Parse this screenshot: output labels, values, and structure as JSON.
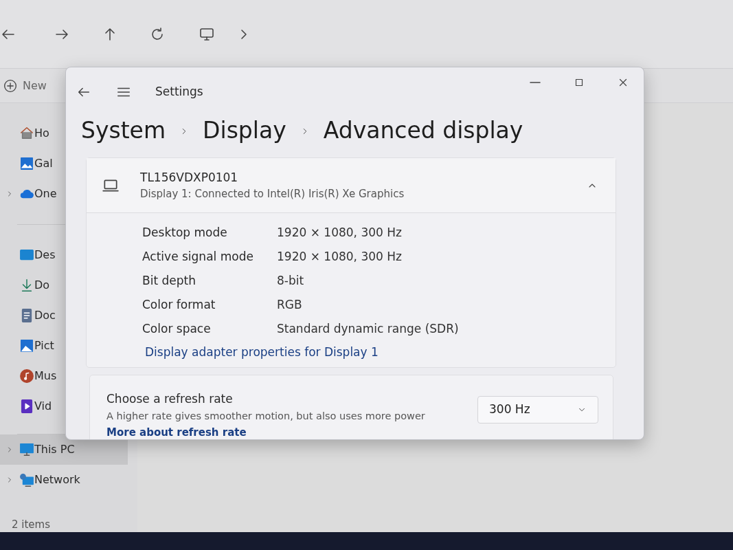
{
  "explorer": {
    "command_bar": {
      "new_label": "New"
    },
    "sidebar": {
      "items": [
        {
          "kind": "home",
          "label": "Ho",
          "selected": false,
          "expandable": false
        },
        {
          "kind": "gallery",
          "label": "Gal",
          "selected": false,
          "expandable": false
        },
        {
          "kind": "cloud",
          "label": "One",
          "selected": false,
          "expandable": true
        },
        {
          "kind": "desktop",
          "label": "Des",
          "selected": false,
          "expandable": false
        },
        {
          "kind": "download",
          "label": "Do",
          "selected": false,
          "expandable": false
        },
        {
          "kind": "document",
          "label": "Doc",
          "selected": false,
          "expandable": false
        },
        {
          "kind": "pictures",
          "label": "Pict",
          "selected": false,
          "expandable": false
        },
        {
          "kind": "music",
          "label": "Mus",
          "selected": false,
          "expandable": false
        },
        {
          "kind": "video",
          "label": "Vid",
          "selected": false,
          "expandable": false
        },
        {
          "kind": "pc",
          "label": "This PC",
          "selected": true,
          "expandable": true
        },
        {
          "kind": "network",
          "label": "Network",
          "selected": false,
          "expandable": true
        }
      ]
    },
    "status_bar": "2 items"
  },
  "settings": {
    "window": {
      "title": "Settings"
    },
    "breadcrumb": [
      "System",
      "Display",
      "Advanced display"
    ],
    "display_card": {
      "name": "TL156VDXP0101",
      "subtitle": "Display 1: Connected to Intel(R) Iris(R) Xe Graphics",
      "expanded": true,
      "details": [
        {
          "label": "Desktop mode",
          "value": "1920 × 1080, 300 Hz"
        },
        {
          "label": "Active signal mode",
          "value": "1920 × 1080, 300 Hz"
        },
        {
          "label": "Bit depth",
          "value": "8-bit"
        },
        {
          "label": "Color format",
          "value": "RGB"
        },
        {
          "label": "Color space",
          "value": "Standard dynamic range (SDR)"
        }
      ],
      "link": "Display adapter properties for Display 1"
    },
    "refresh_rate": {
      "title": "Choose a refresh rate",
      "description": "A higher rate gives smoother motion, but also uses more power",
      "link": "More about refresh rate",
      "value": "300 Hz"
    }
  }
}
